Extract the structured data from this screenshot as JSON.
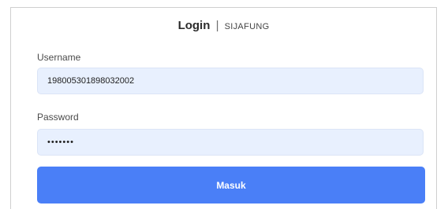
{
  "header": {
    "title_bold": "Login",
    "separator": "|",
    "app_name": "SIJAFUNG"
  },
  "form": {
    "username_label": "Username",
    "username_value": "198005301898032002",
    "password_label": "Password",
    "password_value": "•••••••",
    "submit_label": "Masuk"
  },
  "colors": {
    "accent": "#4a7ff7",
    "field_bg": "#e8f0fe",
    "border": "#cfcfcf"
  }
}
